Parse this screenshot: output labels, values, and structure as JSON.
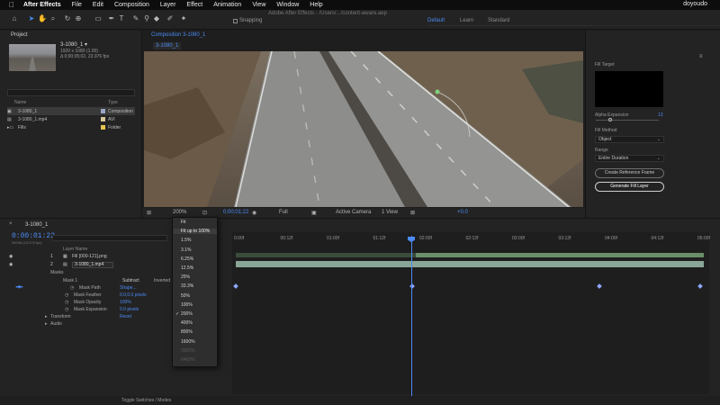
{
  "menubar": {
    "app_name": "After Effects",
    "items": [
      "File",
      "Edit",
      "Composition",
      "Layer",
      "Effect",
      "Animation",
      "View",
      "Window",
      "Help"
    ],
    "right_text": "doyoudo"
  },
  "toolbar": {
    "window_title": "Adobe After Effects - /Users/.../content-aware.aep",
    "snapping_label": "Snapping",
    "workspaces": [
      "Default",
      "Learn",
      "Standard"
    ],
    "active_workspace": "Default"
  },
  "project": {
    "tab": "Project",
    "comp_name": "3-1080_1 ▾",
    "comp_info_lines": [
      "1920 x 1080 (1.00)",
      "Δ 0;00;05;02, 23.976 fps"
    ],
    "columns": [
      "Name",
      "Type"
    ],
    "rows": [
      {
        "name": "3-1080_1",
        "type": "Composition",
        "color": "#9aa6c9"
      },
      {
        "name": "3-1080_1.mp4",
        "type": "AVI",
        "color": "#d6c69a"
      },
      {
        "name": "Fills",
        "type": "Folder",
        "color": "#e6c64d"
      }
    ]
  },
  "viewer": {
    "tab": "Composition 3-1080_1",
    "breadcrumb": "3-1080_1",
    "zoom": "200%",
    "timecode": "0;00;01;22",
    "resolution": "Full",
    "camera": "Active Camera",
    "view": "1 View",
    "exposure": "+0.0"
  },
  "fill_panel": {
    "fill_target_label": "Fill Target",
    "alpha_label": "Alpha Expansion",
    "alpha_value": "13",
    "alpha_fraction": 0.2,
    "fill_method_label": "Fill Method",
    "fill_method_value": "Object",
    "range_label": "Range",
    "range_value": "Entire Duration",
    "btn_reference": "Create Reference Frame",
    "btn_generate": "Generate Fill Layer"
  },
  "timeline": {
    "tab": "3-1080_1",
    "current_time": "0:00:01:22",
    "frames": "00046 (23.976 fps)",
    "layer_header": "Layer Name",
    "layers": [
      {
        "num": "1",
        "name": "Fill [000-121].png"
      },
      {
        "num": "2",
        "name": "3-1080_1.mp4"
      }
    ],
    "props": {
      "masks": "Masks",
      "mask1": "Mask 1",
      "mask_mode": "Subtract",
      "inverted": "Inverted",
      "mask_path": "Mask Path",
      "mask_path_val": "Shape...",
      "mask_feather": "Mask Feather",
      "mask_feather_val": "0.0,0.0 pixels",
      "mask_opacity": "Mask Opacity",
      "mask_opacity_val": "100%",
      "mask_expansion": "Mask Expansion",
      "mask_expansion_val": "0.0 pixels",
      "transform": "Transform",
      "transform_val": "Reset",
      "audio": "Audio"
    },
    "ruler_ticks": [
      "0:00f",
      "00:12f",
      "01:00f",
      "01:12f",
      "02:00f",
      "02:12f",
      "03:00f",
      "03:12f",
      "04:00f",
      "04:12f",
      "05:00f"
    ],
    "bottom_label": "Toggle Switches / Modes"
  },
  "zoom_menu": {
    "items": [
      "Fit",
      "Fit up to 100%",
      "1.5%",
      "3.1%",
      "6.25%",
      "12.5%",
      "25%",
      "33.3%",
      "50%",
      "100%",
      "200%",
      "400%",
      "800%",
      "1600%",
      "3200%",
      "6400%"
    ],
    "checked": "200%",
    "highlighted": "Fit up to 100%"
  }
}
